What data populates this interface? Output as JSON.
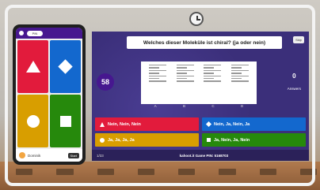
{
  "kahoot": {
    "question": "Welches dieser Moleküle ist chiral? (ja oder nein)",
    "skip_label": "Skip",
    "timer": "58",
    "answers_count": "0",
    "answers_label": "Answers",
    "option_labels": [
      "A",
      "B",
      "C",
      "D"
    ],
    "answers": [
      {
        "label": "Nein, Nein, Nein",
        "color": "#e21b3c",
        "icon": "triangle-icon"
      },
      {
        "label": "Nein, Ja, Nein, Ja",
        "color": "#1368ce",
        "icon": "diamond-icon"
      },
      {
        "label": "Ja, Ja, Ja, Ja",
        "color": "#d89e00",
        "icon": "circle-icon"
      },
      {
        "label": "Ja, Nein, Ja, Nein",
        "color": "#26890c",
        "icon": "square-icon"
      }
    ],
    "progress": "1/33",
    "game_pin_text": "kahoot.it  Game PIN: 5168703"
  },
  "phone": {
    "top_label": "PIN",
    "player_name": "Dominik",
    "score_label": "Start"
  }
}
